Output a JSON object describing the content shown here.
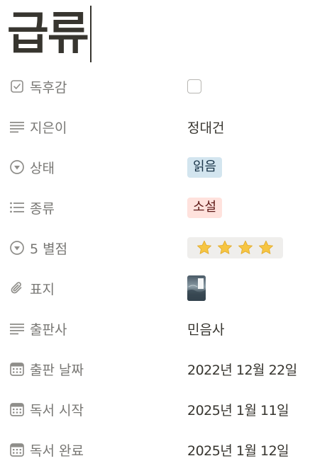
{
  "title": "급류",
  "properties": [
    {
      "key": "read_done",
      "label": "독후감",
      "icon": "checkbox-icon",
      "type": "checkbox",
      "checked": false
    },
    {
      "key": "author",
      "label": "지은이",
      "icon": "text-lines-icon",
      "type": "text",
      "value": "정대건"
    },
    {
      "key": "status",
      "label": "상태",
      "icon": "status-circle-icon",
      "type": "tag",
      "value": "읽음",
      "color": "#d3e5ef"
    },
    {
      "key": "genre",
      "label": "종류",
      "icon": "list-icon",
      "type": "tag",
      "value": "소설",
      "color": "#ffe2dd"
    },
    {
      "key": "rating",
      "label": "5 별점",
      "icon": "status-circle-icon",
      "type": "rating",
      "value": 4,
      "symbol": "⭐"
    },
    {
      "key": "cover",
      "label": "표지",
      "icon": "paperclip-icon",
      "type": "file"
    },
    {
      "key": "publisher",
      "label": "출판사",
      "icon": "text-lines-icon",
      "type": "text",
      "value": "민음사"
    },
    {
      "key": "publish_date",
      "label": "출판 날짜",
      "icon": "calendar-icon",
      "type": "date",
      "value": "2022년 12월 22일"
    },
    {
      "key": "start_date",
      "label": "독서 시작",
      "icon": "calendar-icon",
      "type": "date",
      "value": "2025년 1월 11일"
    },
    {
      "key": "end_date",
      "label": "독서 완료",
      "icon": "calendar-icon",
      "type": "date",
      "value": "2025년 1월 12일"
    }
  ],
  "colors": {
    "label_text": "#787774",
    "value_text": "#37352f",
    "star": "#f6c542",
    "rating_bg": "#efeeec"
  }
}
